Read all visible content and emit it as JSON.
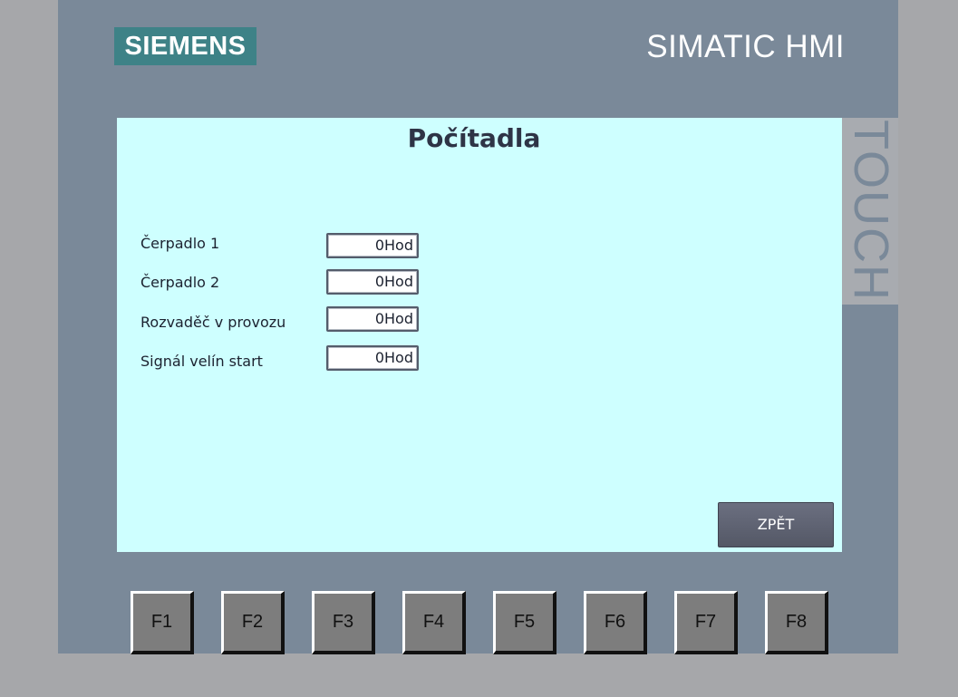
{
  "header": {
    "logo": "SIEMENS",
    "brand": "SIMATIC HMI",
    "touch_label": "TOUCH"
  },
  "screen": {
    "title": "Počítadla",
    "rows": [
      {
        "label": "Čerpadlo 1",
        "value": "0Hod"
      },
      {
        "label": "Čerpadlo 2",
        "value": "0Hod"
      },
      {
        "label": "Rozvaděč v provozu",
        "value": "0Hod"
      },
      {
        "label": "Signál velín start",
        "value": "0Hod"
      }
    ],
    "back_label": "ZPĚT"
  },
  "function_keys": [
    "F1",
    "F2",
    "F3",
    "F4",
    "F5",
    "F6",
    "F7",
    "F8"
  ],
  "colors": {
    "screen_bg": "#ceffff",
    "panel": "#7a8999",
    "logo_bg": "#3e8287"
  }
}
